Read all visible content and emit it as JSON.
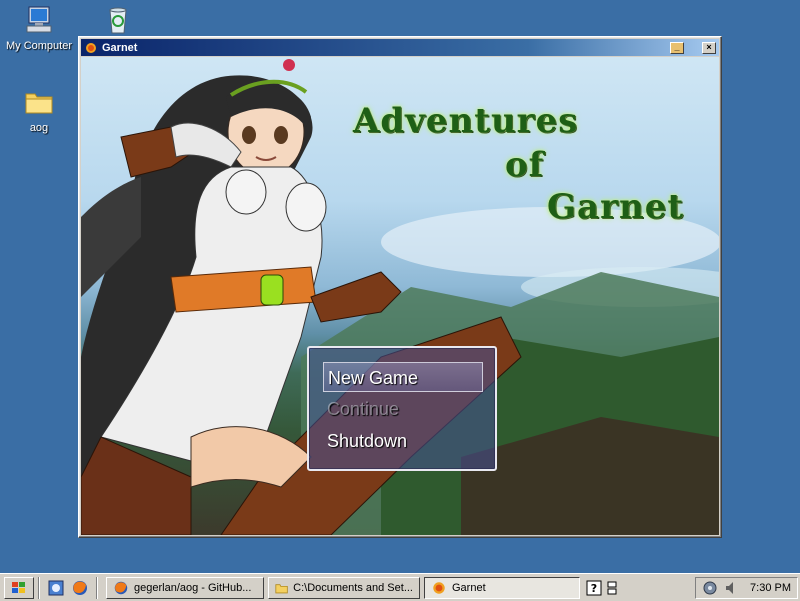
{
  "desktop": {
    "icons": [
      {
        "label": "My Computer",
        "icon": "my-computer-icon"
      },
      {
        "label": "",
        "icon": "recycle-bin-icon"
      },
      {
        "label": "aog",
        "icon": "folder-icon"
      }
    ]
  },
  "window": {
    "title": "Garnet",
    "icon": "garnet-app-icon",
    "buttons": [
      "minimize",
      "close"
    ]
  },
  "game": {
    "logo": [
      "Adventures",
      "of",
      "Garnet"
    ],
    "menu": [
      {
        "label": "New Game",
        "state": "selected"
      },
      {
        "label": "Continue",
        "state": "disabled"
      },
      {
        "label": "Shutdown",
        "state": "normal"
      }
    ]
  },
  "taskbar": {
    "tasks": [
      {
        "label": "gegerlan/aog - GitHub...",
        "icon": "firefox-icon"
      },
      {
        "label": "C:\\Documents and Set...",
        "icon": "folder-icon"
      },
      {
        "label": "Garnet",
        "icon": "garnet-app-icon",
        "active": true
      }
    ],
    "clock": "7:30 PM"
  }
}
